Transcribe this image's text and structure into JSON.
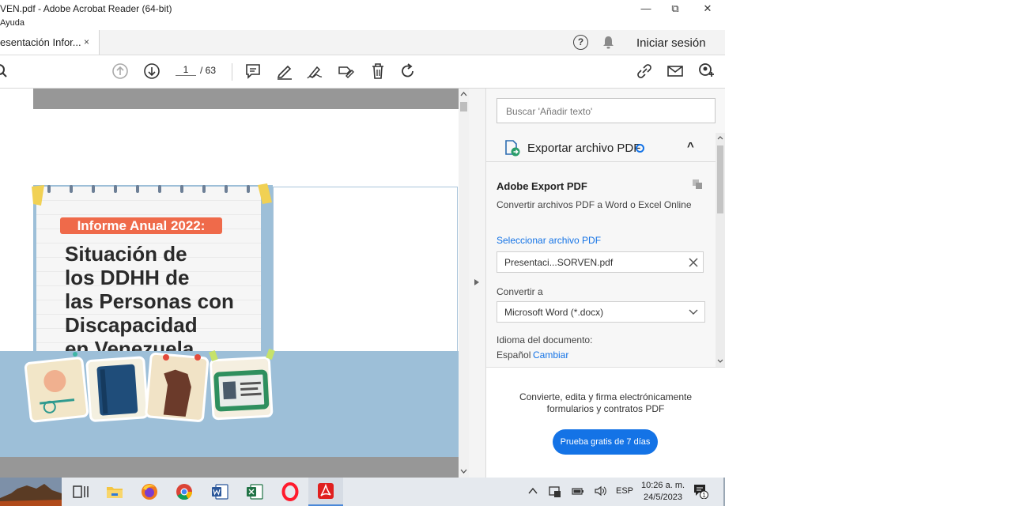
{
  "window": {
    "title": "VEN.pdf - Adobe Acrobat Reader (64-bit)",
    "menu": "Ayuda"
  },
  "tabbar": {
    "tab_label": "esentación Infor...",
    "tab_close": "×",
    "signin": "Iniciar sesión"
  },
  "toolbar": {
    "page_current": "1",
    "page_total": "/ 63"
  },
  "document": {
    "label": "Informe Anual 2022:",
    "heading": [
      "Situación de",
      "los DDHH de",
      "las Personas con",
      "Discapacidad",
      "en Venezuela"
    ]
  },
  "panel": {
    "search_placeholder": "Buscar 'Añadir texto'",
    "export_title": "Exportar archivo PDF",
    "adobe_export_title": "Adobe Export PDF",
    "adobe_export_desc": "Convertir archivos PDF a Word o Excel Online",
    "select_file_link": "Seleccionar archivo PDF",
    "selected_file": "Presentaci...SORVEN.pdf",
    "convert_to_label": "Convertir a",
    "convert_to_value": "Microsoft Word (*.docx)",
    "doc_language_label": "Idioma del documento:",
    "doc_language_value": "Español",
    "change_link": "Cambiar",
    "promo_text_1": "Convierte, edita y firma electrónicamente",
    "promo_text_2": "formularios y contratos PDF",
    "trial_button": "Prueba gratis de 7 días"
  },
  "taskbar": {
    "lang": "ESP",
    "time": "10:26 a. m.",
    "date": "24/5/2023",
    "notif_count": "1"
  },
  "colors": {
    "accent": "#1473e6",
    "label_red": "#ef6a4a",
    "page_bg_blue": "#9dbfd8",
    "acrobat_red": "#e0201f"
  }
}
